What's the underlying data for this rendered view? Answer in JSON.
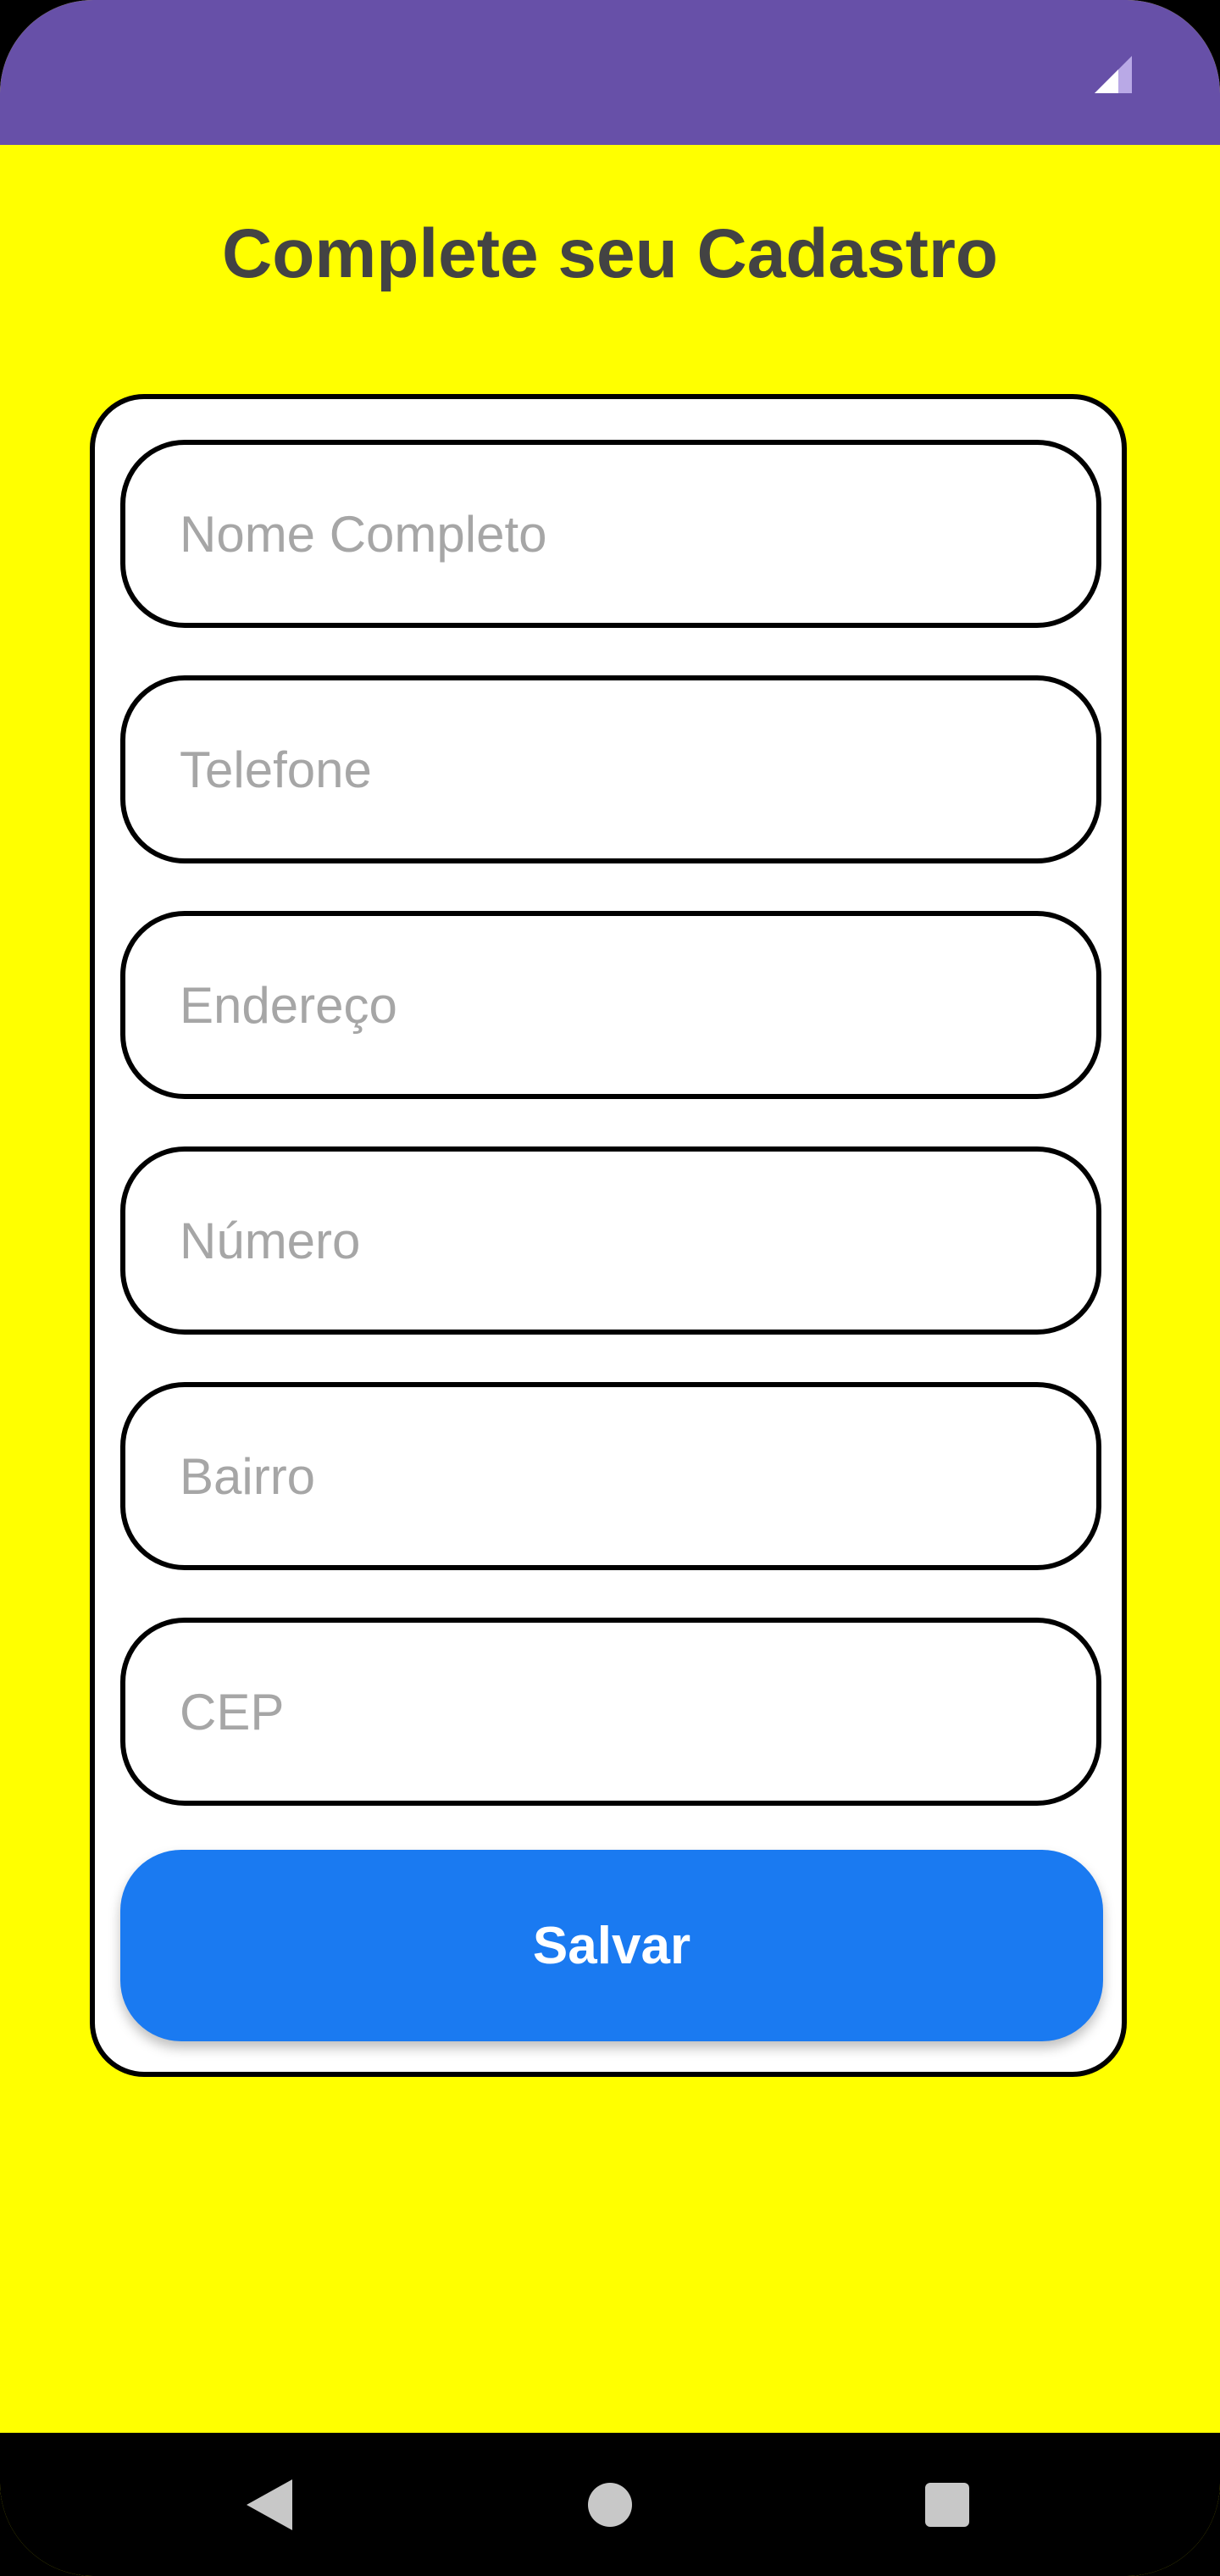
{
  "form": {
    "title": "Complete seu Cadastro",
    "fields": [
      {
        "placeholder": "Nome Completo",
        "value": ""
      },
      {
        "placeholder": "Telefone",
        "value": ""
      },
      {
        "placeholder": "Endereço",
        "value": ""
      },
      {
        "placeholder": "Número",
        "value": ""
      },
      {
        "placeholder": "Bairro",
        "value": ""
      },
      {
        "placeholder": "CEP",
        "value": ""
      }
    ],
    "save_label": "Salvar"
  },
  "status_bar": {
    "icons": [
      "signal-icon"
    ]
  },
  "nav_bar": {
    "icons": [
      "back-icon",
      "home-icon",
      "recents-icon"
    ]
  },
  "colors": {
    "status_bar": "#6750a8",
    "background": "#ffff00",
    "card": "#ffffff",
    "title": "#434343",
    "placeholder": "#a6a6a6",
    "button": "#1a7af1",
    "button_text": "#ffffff",
    "nav_bar": "#000000"
  }
}
